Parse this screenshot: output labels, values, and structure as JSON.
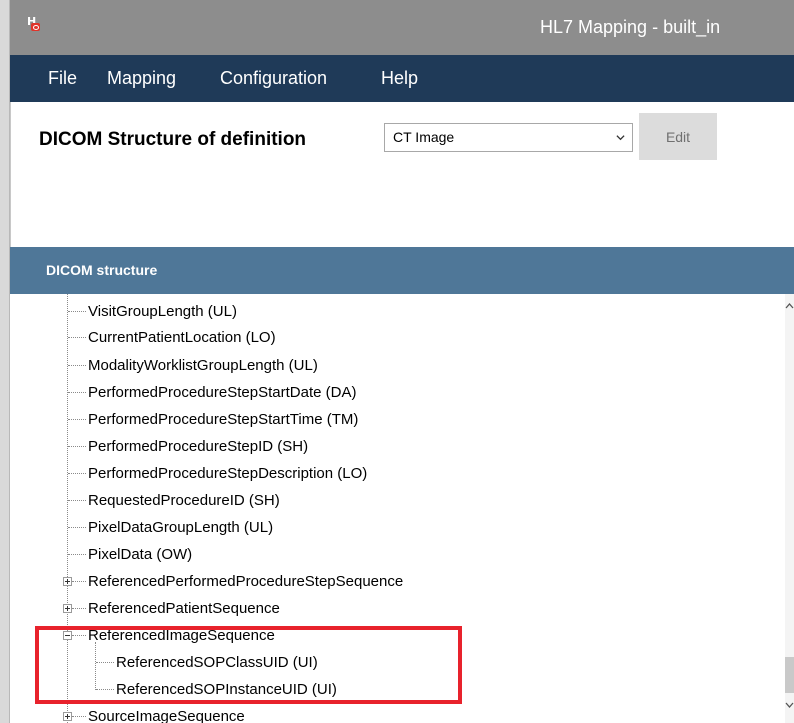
{
  "window": {
    "title": "HL7 Mapping  - built_in"
  },
  "menu": {
    "items": [
      "File",
      "Mapping",
      "Configuration",
      "Help"
    ]
  },
  "toolbar": {
    "definition_label": "DICOM Structure of definition",
    "definition_value": "CT Image",
    "edit_label": "Edit"
  },
  "panel": {
    "title": "DICOM structure"
  },
  "tree": {
    "items": [
      {
        "label": "VisitGroupLength (UL)",
        "level": 1
      },
      {
        "label": "CurrentPatientLocation (LO)",
        "level": 1
      },
      {
        "label": "ModalityWorklistGroupLength (UL)",
        "level": 1
      },
      {
        "label": "PerformedProcedureStepStartDate (DA)",
        "level": 1
      },
      {
        "label": "PerformedProcedureStepStartTime (TM)",
        "level": 1
      },
      {
        "label": "PerformedProcedureStepID (SH)",
        "level": 1
      },
      {
        "label": "PerformedProcedureStepDescription (LO)",
        "level": 1
      },
      {
        "label": "RequestedProcedureID (SH)",
        "level": 1
      },
      {
        "label": "PixelDataGroupLength (UL)",
        "level": 1
      },
      {
        "label": "PixelData (OW)",
        "level": 1
      },
      {
        "label": "ReferencedPerformedProcedureStepSequence",
        "level": 1,
        "expander": "collapsed"
      },
      {
        "label": "ReferencedPatientSequence",
        "level": 1,
        "expander": "collapsed"
      },
      {
        "label": "ReferencedImageSequence",
        "level": 1,
        "expander": "expanded"
      },
      {
        "label": "ReferencedSOPClassUID (UI)",
        "level": 2
      },
      {
        "label": "ReferencedSOPInstanceUID (UI)",
        "level": 2
      },
      {
        "label": "SourceImageSequence",
        "level": 1,
        "expander": "collapsed"
      }
    ]
  },
  "annotation": {
    "highlight_color": "#e8222c"
  },
  "colors": {
    "titlebar": "#8d8d8d",
    "menubar": "#1f3a58",
    "panel_header": "#4f7798"
  }
}
